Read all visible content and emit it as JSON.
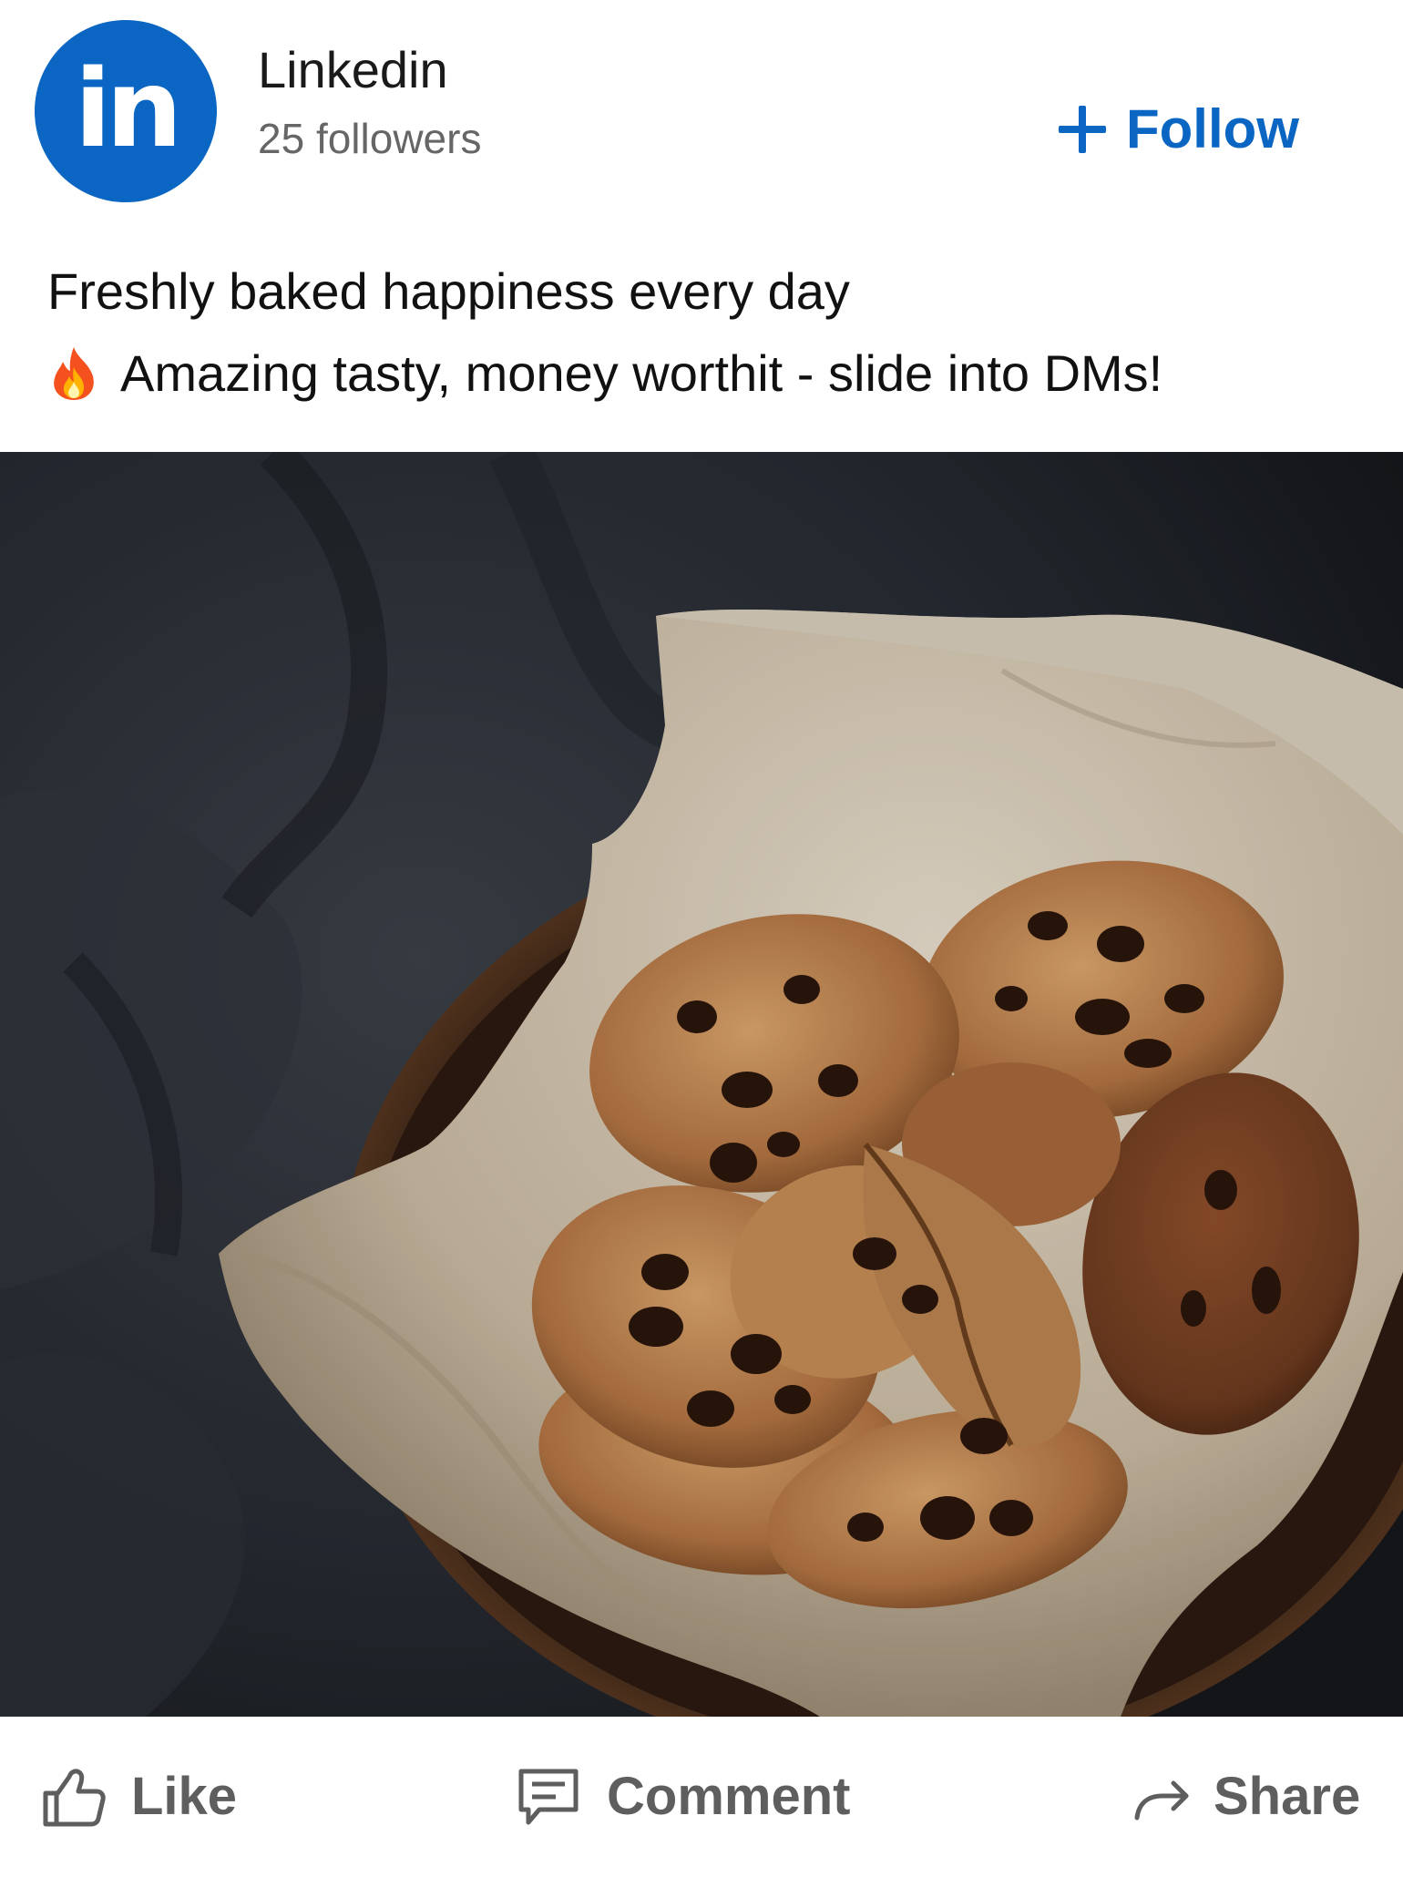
{
  "post": {
    "author": {
      "name": "Linkedin",
      "followers": "25 followers",
      "logo_text": "in",
      "logo_color": "#0a66c2"
    },
    "follow_label": "Follow",
    "text_lines": [
      "Freshly baked happiness every day",
      "Amazing tasty, money worthit - slide into DMs!"
    ],
    "image": {
      "subject": "chocolate chip cookies in a bowl lined with parchment paper on a dark cloth"
    },
    "actions": {
      "like": "Like",
      "comment": "Comment",
      "share": "Share"
    }
  },
  "colors": {
    "accent": "#0a66c2",
    "action_gray": "#5e5e5e",
    "text": "#111111",
    "muted": "#666666"
  }
}
